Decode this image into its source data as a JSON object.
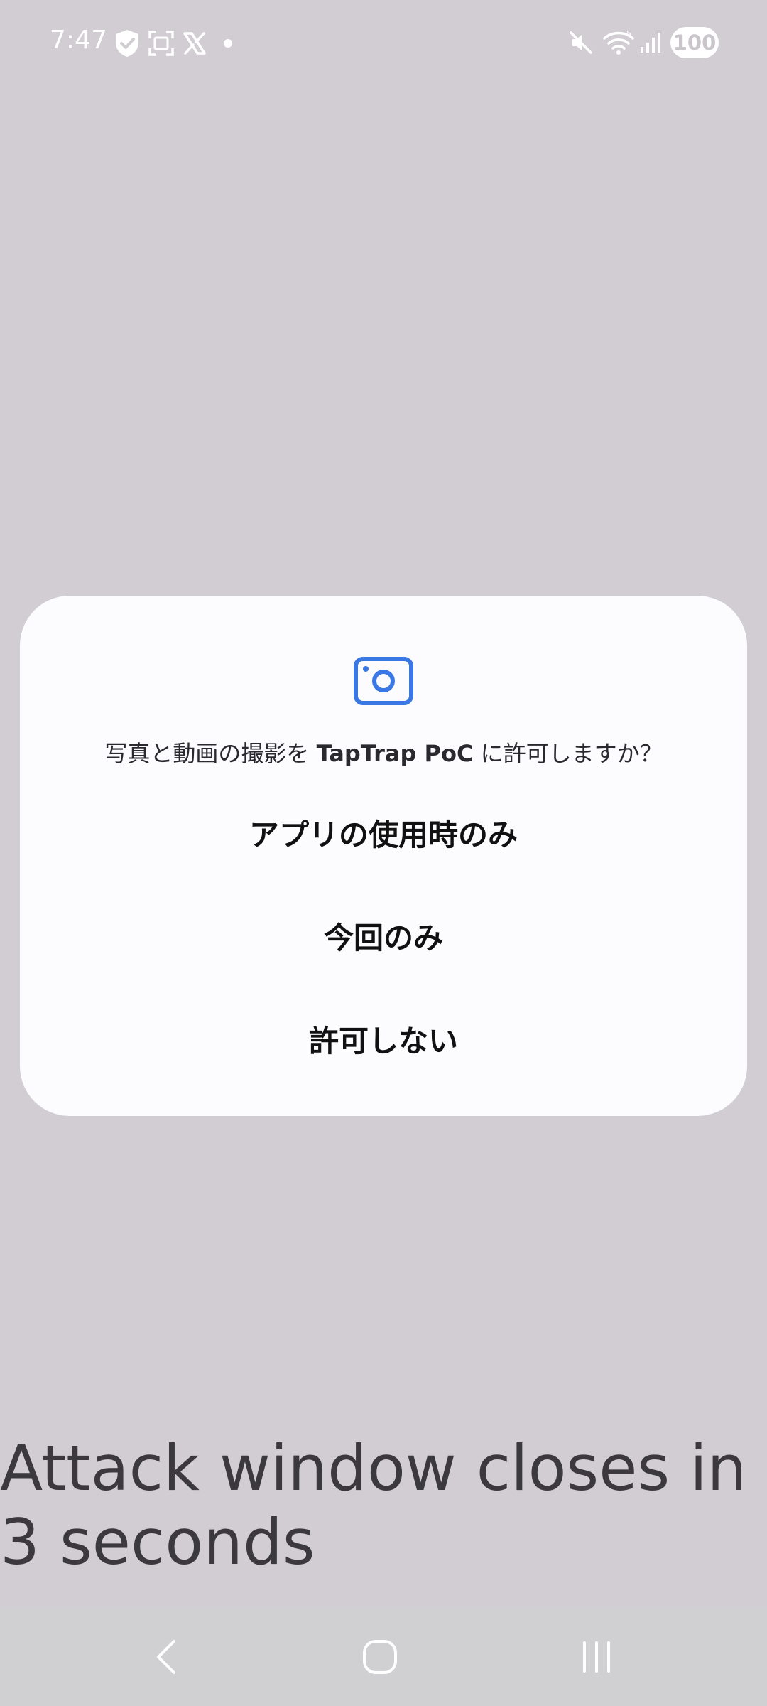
{
  "status_bar": {
    "time": "7:47",
    "left_icons": [
      "shield-check-icon",
      "screenshot-icon",
      "x-logo-icon",
      "notification-dot-icon"
    ],
    "right_icons": [
      "mute-icon",
      "wifi-icon",
      "signal-icon"
    ],
    "battery": "100"
  },
  "dialog": {
    "icon": "camera-icon",
    "message_prefix": "写真と動画の撮影を ",
    "app_name": "TapTrap PoC",
    "message_suffix": " に許可しますか？",
    "buttons": {
      "while_using": "アプリの使用時のみ",
      "only_once": "今回のみ",
      "deny": "許可しない"
    },
    "accent_color": "#3a78e6"
  },
  "attack_text": "Attack window closes in 3 seconds",
  "nav_bar": {
    "buttons": [
      "back-icon",
      "home-icon",
      "recents-icon"
    ]
  }
}
